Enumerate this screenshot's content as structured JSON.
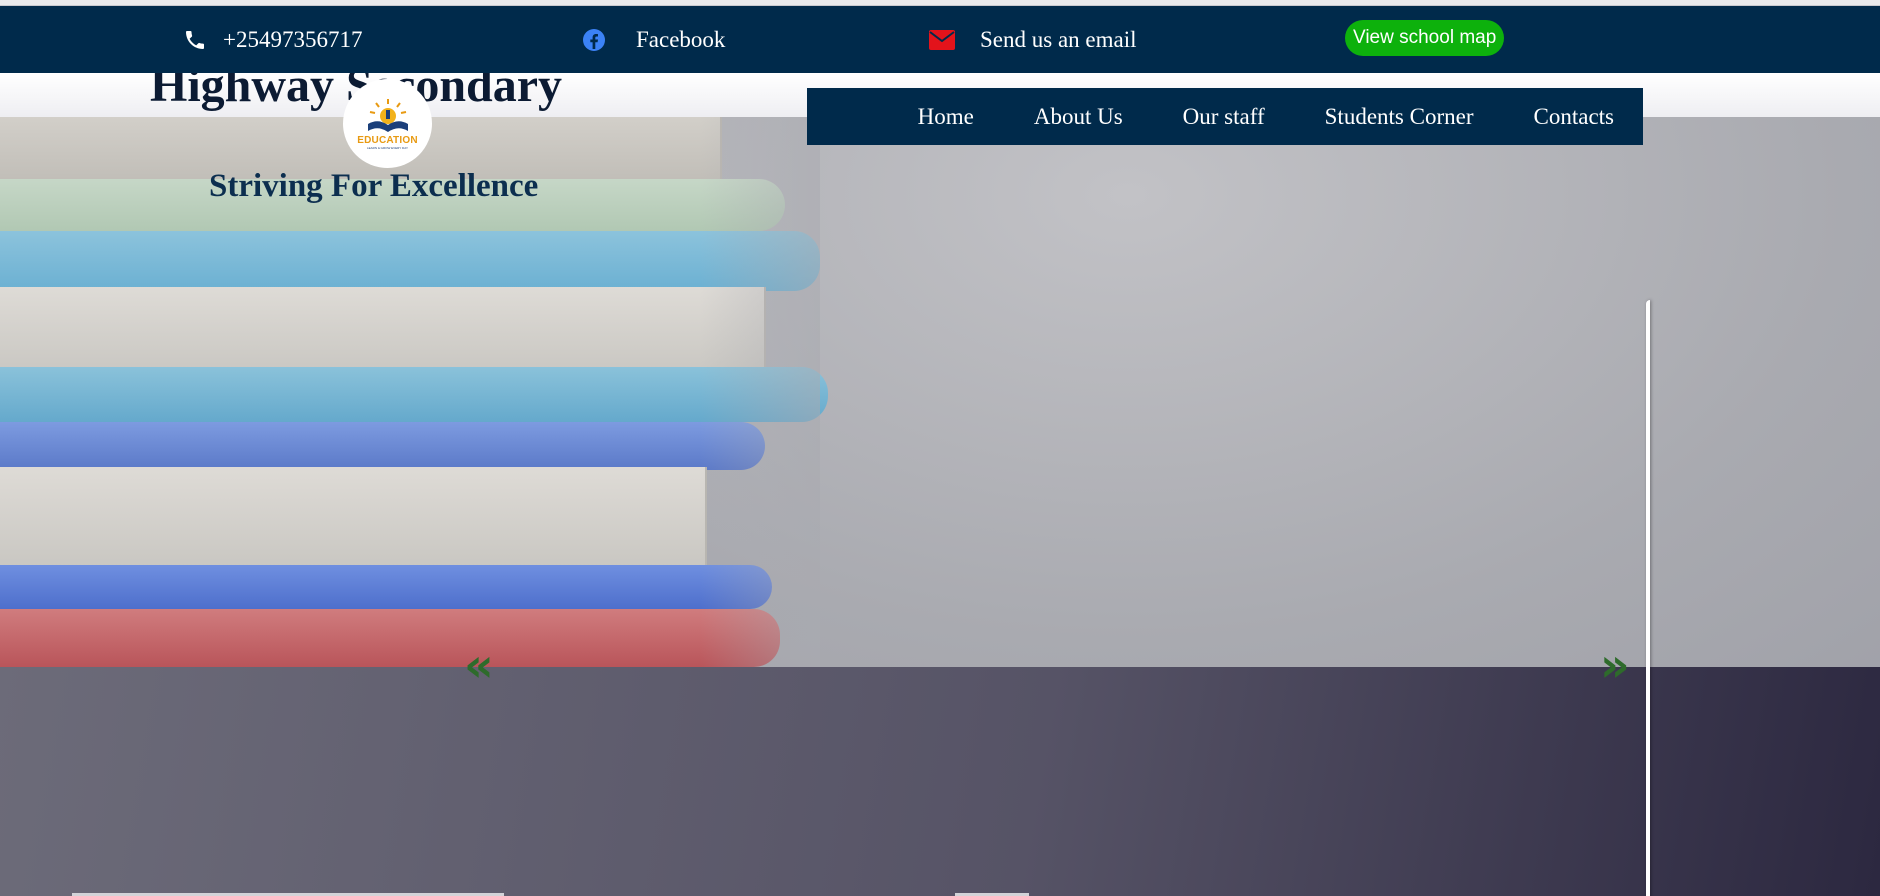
{
  "topbar": {
    "phone": "+25497356717",
    "facebook": "Facebook",
    "email": "Send us an email",
    "map_button": "View school map",
    "phone_icon": "phone-icon",
    "facebook_icon": "facebook-icon",
    "email_icon": "envelope-icon"
  },
  "header": {
    "cut_title": "Highway Secondary",
    "logo_text": "EDUCATION",
    "logo_sub": "LEARN & GROW EVERY DAY",
    "tagline": "Striving For Excellence"
  },
  "nav": {
    "items": [
      "Home",
      "About Us",
      "Our staff",
      "Students Corner",
      "Contacts"
    ]
  },
  "slider": {
    "prev_label": "«",
    "next_label": "»"
  },
  "colors": {
    "navy": "#002a4b",
    "green_button": "#0db10c",
    "email_icon": "#e3131b",
    "facebook_icon": "#3b82f6",
    "arrow_green": "#2e6b2b"
  }
}
